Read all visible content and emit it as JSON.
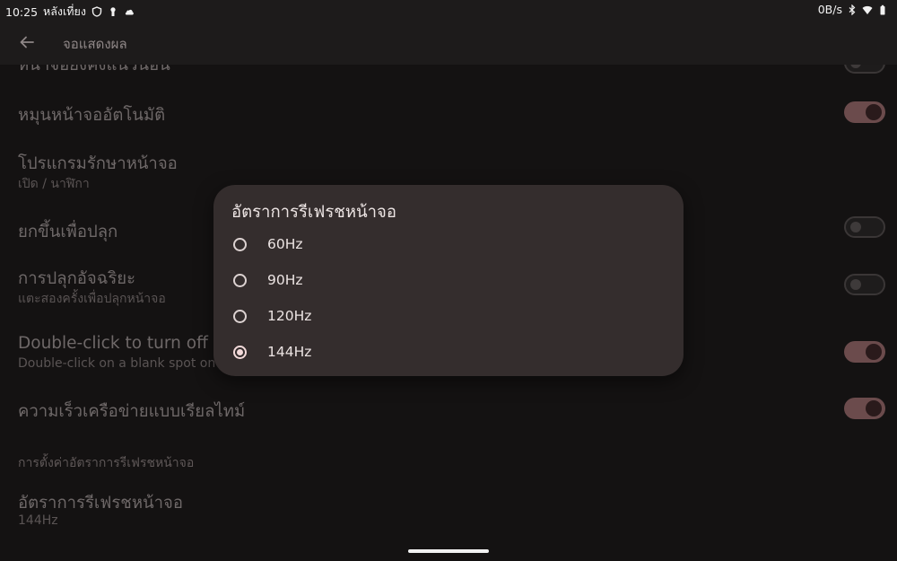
{
  "status_bar": {
    "time": "10:25",
    "period": "หลังเที่ยง",
    "speed": "0B/s",
    "icons": [
      "shield-icon",
      "keyhole-icon",
      "cloud-icon",
      "bluetooth-icon",
      "wifi-icon",
      "battery-icon"
    ]
  },
  "app_bar": {
    "title": "จอแสดงผล",
    "back_icon": "arrow-back-icon"
  },
  "settings": {
    "partial_row_title": "หน้าจอยังคงแนวนอน",
    "auto_rotate": {
      "title": "หมุนหน้าจออัตโนมัติ",
      "on": true
    },
    "screensaver": {
      "title": "โปรแกรมรักษาหน้าจอ",
      "subtitle": "เปิด / นาฬิกา"
    },
    "lift_to_wake": {
      "title": "ยกขึ้นเพื่อปลุก",
      "on": false
    },
    "smart_wake": {
      "title": "การปลุกอัจฉริยะ",
      "subtitle": "แตะสองครั้งเพื่อปลุกหน้าจอ",
      "on": false
    },
    "double_click": {
      "title": "Double-click to turn off th",
      "subtitle": "Double-click on a blank spot on",
      "on": true
    },
    "realtime_speed": {
      "title": "ความเร็วเครือข่ายแบบเรียลไทม์",
      "on": true
    },
    "refresh_section_header": "การตั้งค่าอัตราการรีเฟรชหน้าจอ",
    "refresh_rate": {
      "title": "อัตราการรีเฟรชหน้าจอ",
      "subtitle": "144Hz"
    }
  },
  "dialog": {
    "title": "อัตราการรีเฟรชหน้าจอ",
    "options": [
      {
        "label": "60Hz",
        "selected": false
      },
      {
        "label": "90Hz",
        "selected": false
      },
      {
        "label": "120Hz",
        "selected": false
      },
      {
        "label": "144Hz",
        "selected": true
      }
    ]
  },
  "colors": {
    "background": "#141212",
    "dialog": "#342d2d",
    "switch_on": "#6b4b4c",
    "accent": "#f3dada"
  }
}
